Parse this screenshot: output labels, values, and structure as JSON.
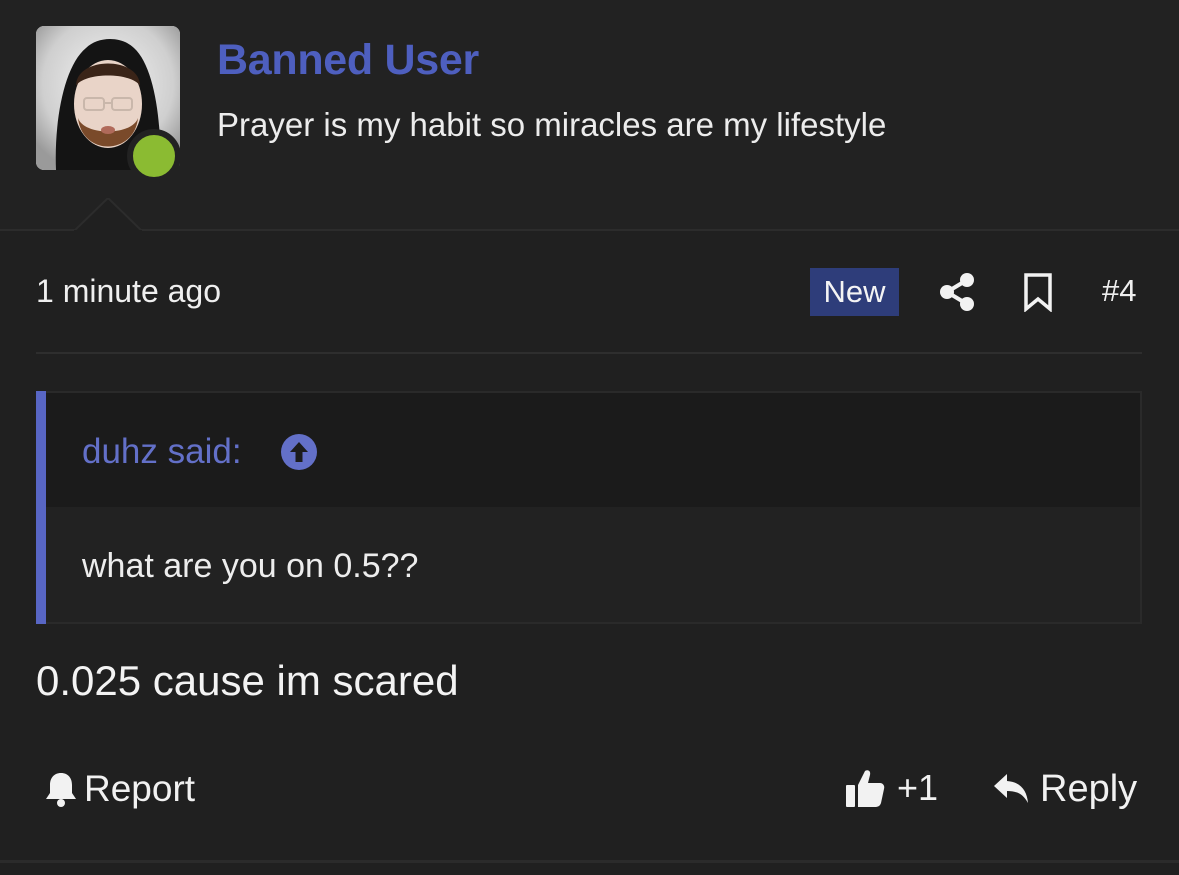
{
  "user": {
    "name": "Banned User",
    "title": "Prayer is my habit so miracles are my lifestyle",
    "online": true
  },
  "post": {
    "time": "1 minute ago",
    "badge": "New",
    "number": "#4",
    "body": "0.025 cause im scared"
  },
  "quote": {
    "author_label": "duhz said:",
    "text": "what are you on 0.5??"
  },
  "actions": {
    "report": "Report",
    "like_count": "+1",
    "reply": "Reply"
  },
  "icons": {
    "share": "share-icon",
    "bookmark": "bookmark-icon",
    "quote_up": "arrow-up-circle-icon",
    "report": "bell-icon",
    "like": "thumbs-up-icon",
    "reply": "reply-arrow-icon"
  },
  "colors": {
    "accent": "#4e5fbf",
    "quote_accent": "#5866c4",
    "badge_bg": "#2e3d7a",
    "online": "#8bbb32",
    "background": "#202020"
  }
}
